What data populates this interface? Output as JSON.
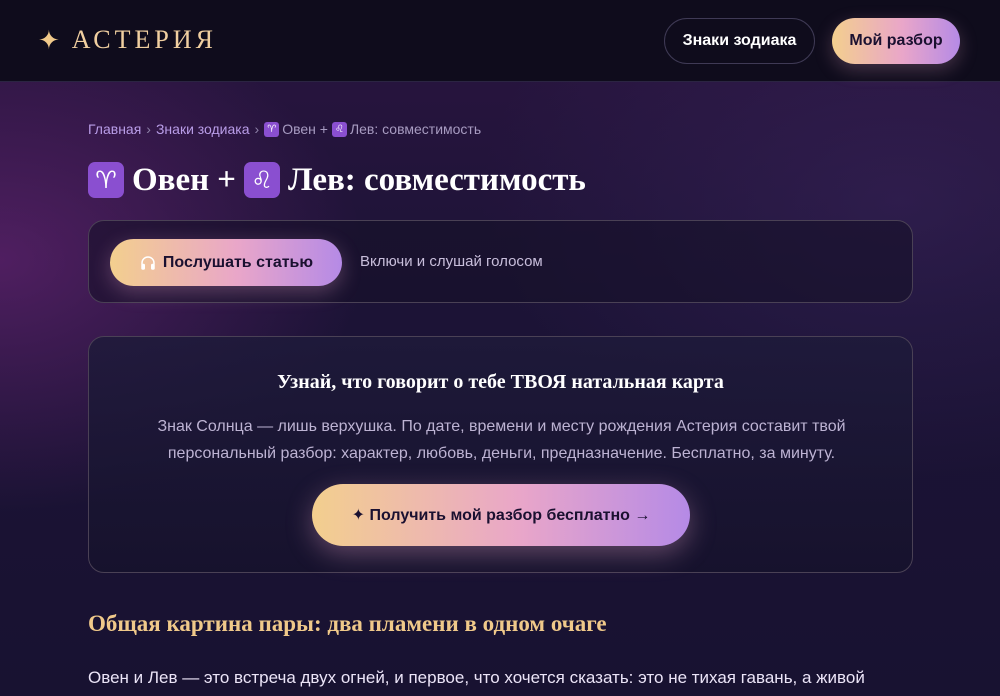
{
  "header": {
    "logo_star": "✦",
    "logo_text": "АСТЕРИЯ",
    "nav": {
      "zodiac_label": "Знаки зодиака",
      "reading_label": "Мой разбор"
    }
  },
  "breadcrumb": {
    "home": "Главная",
    "sep": "›",
    "zodiac": "Знаки зодиака",
    "aries_glyph": "♈",
    "leo_glyph": "♌",
    "current_a": "Овен +",
    "current_b": "Лев: совместимость"
  },
  "title": {
    "aries_glyph": "♈",
    "part1": "Овен",
    "plus": "+",
    "leo_glyph": "♌",
    "part2": "Лев: совместимость"
  },
  "listen": {
    "button_label": "Послушать статью",
    "hint": "Включи и слушай голосом"
  },
  "promo": {
    "title": "Узнай, что говорит о тебе ТВОЯ натальная карта",
    "text_line1": "Знак Солнца — лишь верхушка. По дате, времени и месту рождения Астерия составит твой",
    "text_line2": "персональный разбор: характер, любовь, деньги, предназначение. Бесплатно, за минуту.",
    "button_label": "✦ Получить мой разбор бесплатно →"
  },
  "section": {
    "heading": "Общая картина пары: два пламени в одном очаге",
    "paragraph": "Овен и Лев — это встреча двух огней, и первое, что хочется сказать: это не тихая гавань, а живой"
  },
  "colors": {
    "accent_gold": "#f0c98a",
    "accent_pink": "#e9a6c9",
    "accent_violet": "#b58ae6",
    "zodiac_badge": "#8a4fd0"
  }
}
